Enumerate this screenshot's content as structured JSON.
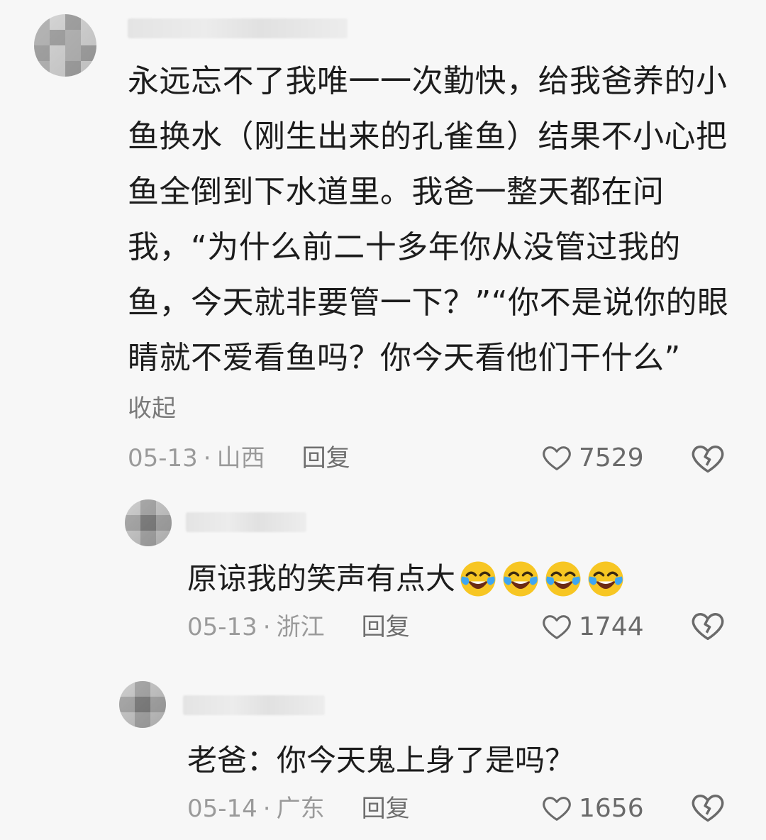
{
  "comments": [
    {
      "text": "永远忘不了我唯一一次勤快，给我爸养的小鱼换水（刚生出来的孔雀鱼）结果不小心把鱼全倒到下水道里。我爸一整天都在问我，“为什么前二十多年你从没管过我的鱼，今天就非要管一下？”“你不是说你的眼睛就不爱看鱼吗？你今天看他们干什么”",
      "collapse_label": "收起",
      "date": "05-13",
      "region": "山西",
      "reply_label": "回复",
      "likes": "7529",
      "replies": [
        {
          "text": "原谅我的笑声有点大",
          "emoji": "face-with-tears-of-joy",
          "emoji_count": 4,
          "date": "05-13",
          "region": "浙江",
          "reply_label": "回复",
          "likes": "1744"
        },
        {
          "text": "老爸：你今天鬼上身了是吗？",
          "date": "05-14",
          "region": "广东",
          "reply_label": "回复",
          "likes": "1656"
        }
      ]
    }
  ],
  "colors": {
    "background": "#f7f7f7",
    "text": "#1c1c1c",
    "meta": "#9a9a9a",
    "icon": "#6a6a6a"
  }
}
